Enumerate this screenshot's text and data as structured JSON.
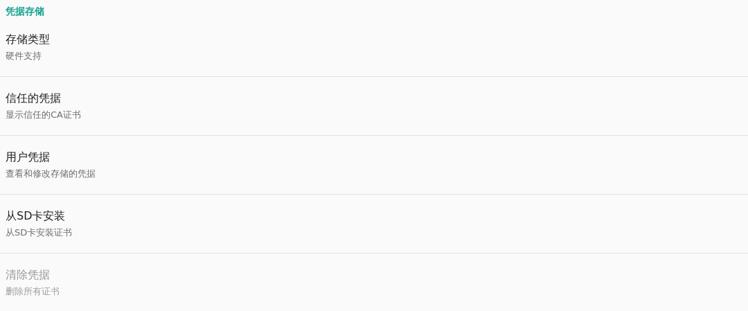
{
  "section_header": "凭据存储",
  "items": [
    {
      "title": "存储类型",
      "summary": "硬件支持",
      "disabled": false
    },
    {
      "title": "信任的凭据",
      "summary": "显示信任的CA证书",
      "disabled": false
    },
    {
      "title": "用户凭据",
      "summary": "查看和修改存储的凭据",
      "disabled": false
    },
    {
      "title": "从SD卡安装",
      "summary": "从SD卡安装证书",
      "disabled": false
    },
    {
      "title": "清除凭据",
      "summary": "删除所有证书",
      "disabled": true
    }
  ]
}
